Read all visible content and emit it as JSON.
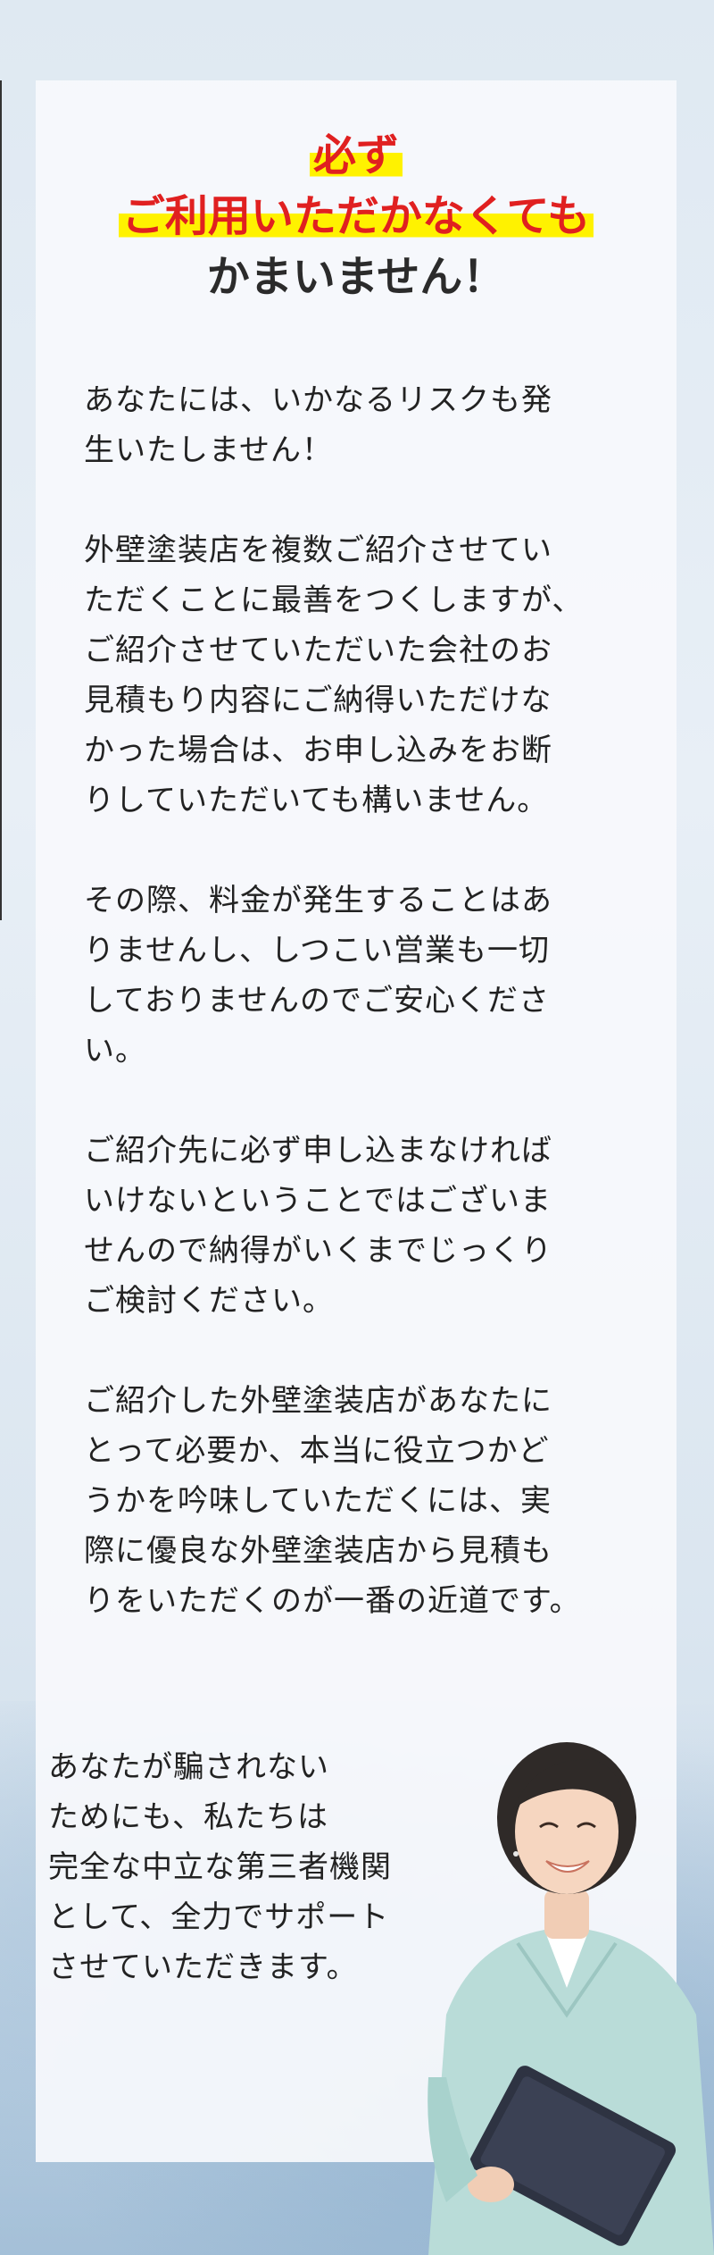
{
  "headline": {
    "line1": "必ず",
    "line2": "ご利用いただかなくても",
    "line3": "かまいません！"
  },
  "paragraphs": [
    "あなたには、いかなるリスクも発\n生いたしません！",
    "外壁塗装店を複数ご紹介させてい\nただくことに最善をつくしますが、\nご紹介させていただいた会社のお\n見積もり内容にご納得いただけな\nかった場合は、お申し込みをお断\nりしていただいても構いません。",
    "その際、料金が発生することはあ\nりませんし、しつこい営業も一切\nしておりませんのでご安心くださ\nい。",
    "ご紹介先に必ず申し込まなければ\nいけないということではございま\nせんので納得がいくまでじっくり\nご検討ください。",
    "ご紹介した外壁塗装店があなたに\nとって必要か、本当に役立つかど\nうかを吟味していただくには、実\n際に優良な外壁塗装店から見積も\nりをいただくのが一番の近道です。"
  ],
  "closing": "あなたが騙されない\nためにも、私たちは\n完全な中立な第三者機関\nとして、全力でサポート\nさせていただきます。",
  "colors": {
    "accent_red": "#e02020",
    "highlight_yellow": "#fff200",
    "text_dark": "#222222"
  },
  "illustration": "smiling-woman-with-tablet"
}
